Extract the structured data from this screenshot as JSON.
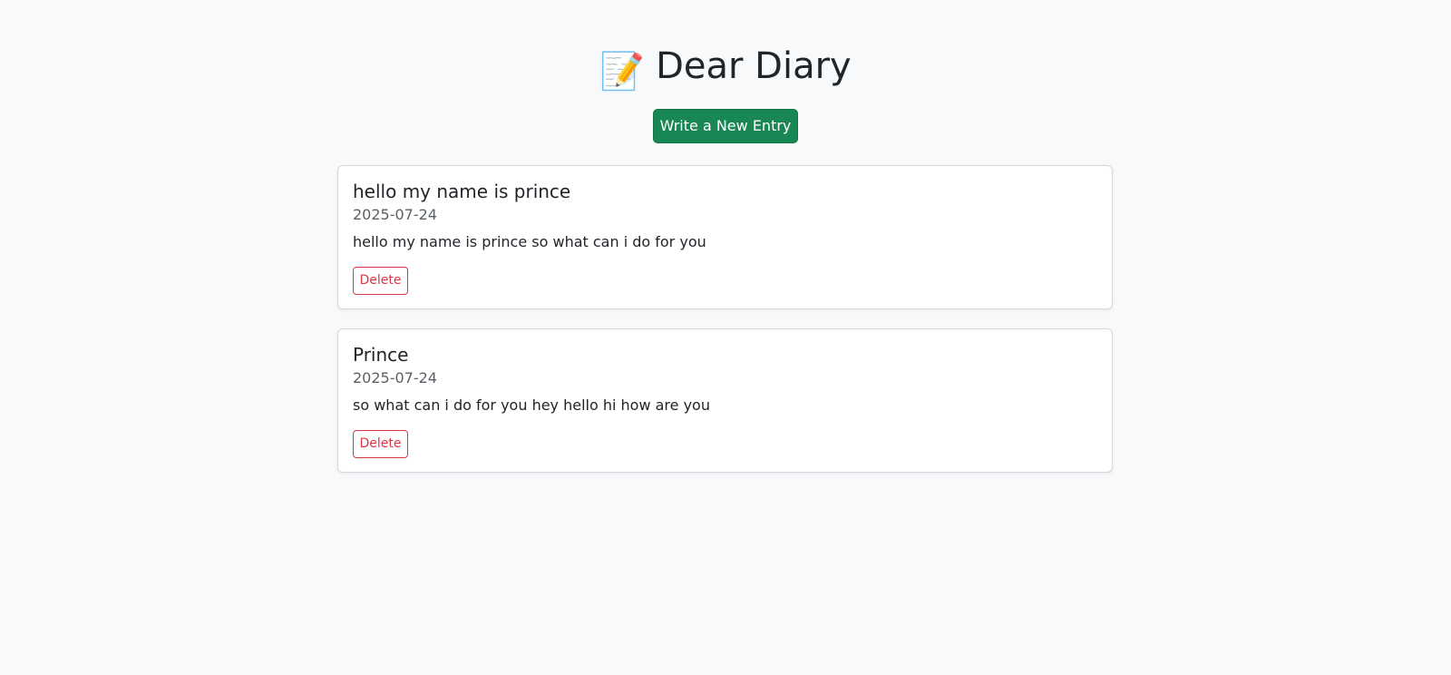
{
  "header": {
    "emoji": "📝",
    "title": "Dear Diary",
    "new_entry_label": "Write a New Entry"
  },
  "entries": [
    {
      "title": "hello my name is prince",
      "date": "2025-07-24",
      "text": "hello my name is prince so what can i do for you",
      "delete_label": "Delete"
    },
    {
      "title": "Prince",
      "date": "2025-07-24",
      "text": "so what can i do for you hey hello hi how are you",
      "delete_label": "Delete"
    }
  ],
  "colors": {
    "background": "#f8f9fa",
    "primary_button": "#198754",
    "danger": "#dc3545",
    "muted_text": "#595f65"
  }
}
